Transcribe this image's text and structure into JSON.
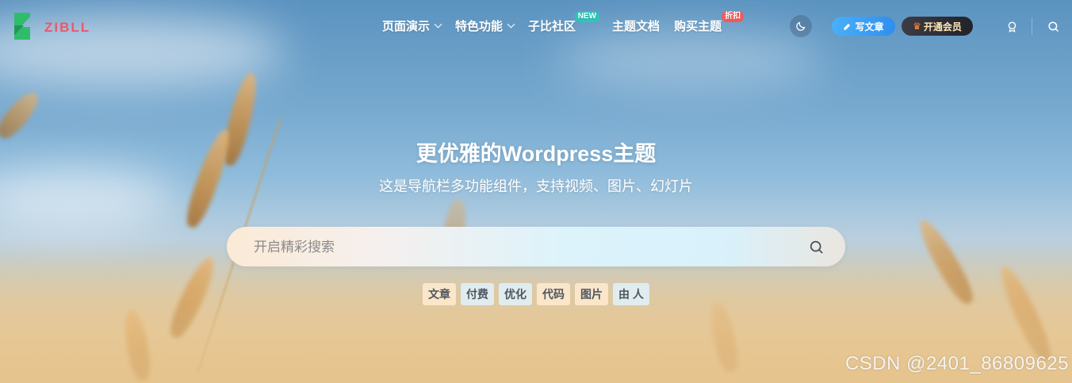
{
  "nav": {
    "logo_text": "ZIBLL",
    "menu": [
      {
        "label": "页面演示",
        "has_dropdown": true
      },
      {
        "label": "特色功能",
        "has_dropdown": true
      },
      {
        "label": "子比社区",
        "badge": "NEW"
      },
      {
        "label": "主题文档"
      },
      {
        "label": "购买主题",
        "badge": "折扣"
      }
    ],
    "write_label": "写文章",
    "vip_label": "开通会员",
    "icons": {
      "theme_toggle": "moon-icon",
      "write": "pencil-icon",
      "vip": "crown-icon",
      "user": "user-icon",
      "search": "search-icon"
    }
  },
  "hero": {
    "title": "更优雅的Wordpress主题",
    "subtitle": "这是导航栏多功能组件，支持视频、图片、幻灯片",
    "search_placeholder": "开启精彩搜索",
    "tags": [
      "文章",
      "付费",
      "优化",
      "代码",
      "图片",
      "由 人"
    ]
  },
  "watermark": "CSDN @2401_86809625",
  "colors": {
    "brand_green": "#2ebd6b",
    "brand_red": "#f0566a",
    "write_button": "#2f8ef0",
    "vip_button": "#22232a",
    "badge_new": "#2fc5b9",
    "badge_sale": "#f25b5b"
  }
}
